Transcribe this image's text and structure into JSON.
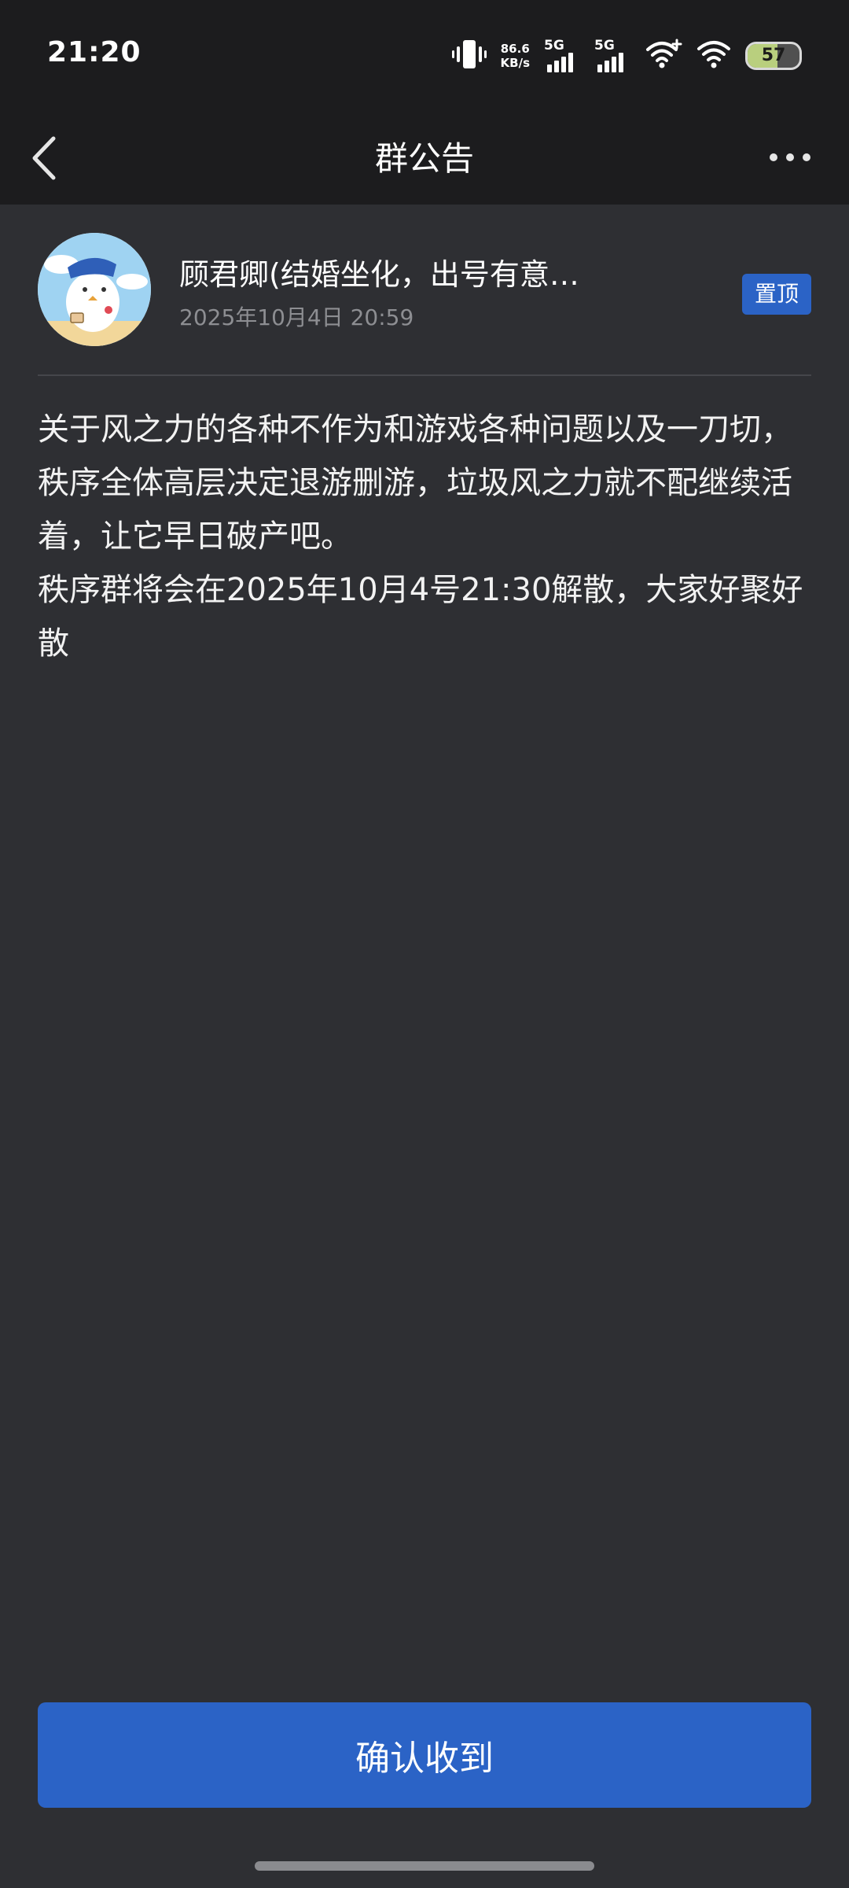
{
  "status_bar": {
    "time": "21:20",
    "net_speed_value": "86.6",
    "net_speed_unit": "KB/s",
    "sim1_label": "5G",
    "sim2_label": "5G",
    "battery_level": "57",
    "battery_fraction": 0.57,
    "icons": [
      "vibrate-icon",
      "signal-icon",
      "wifi-plus-icon",
      "wifi-icon",
      "battery-icon"
    ]
  },
  "header": {
    "title": "群公告",
    "back_icon": "chevron-left-icon",
    "more_icon": "more-dots-icon"
  },
  "notice": {
    "author_name": "顾君卿(结婚坐化，出号有意…",
    "posted_at": "2025年10月4日 20:59",
    "pin_label": "置顶",
    "body": "关于风之力的各种不作为和游戏各种问题以及一刀切，秩序全体高层决定退游删游，垃圾风之力就不配继续活着，让它早日破产吧。\n秩序群将会在2025年10月4号21:30解散，大家好聚好散"
  },
  "footer": {
    "confirm_label": "确认收到"
  },
  "colors": {
    "background": "#2e2f33",
    "bar_background": "#1c1c1e",
    "accent": "#2b63c6",
    "secondary_text": "#8d8e92"
  }
}
